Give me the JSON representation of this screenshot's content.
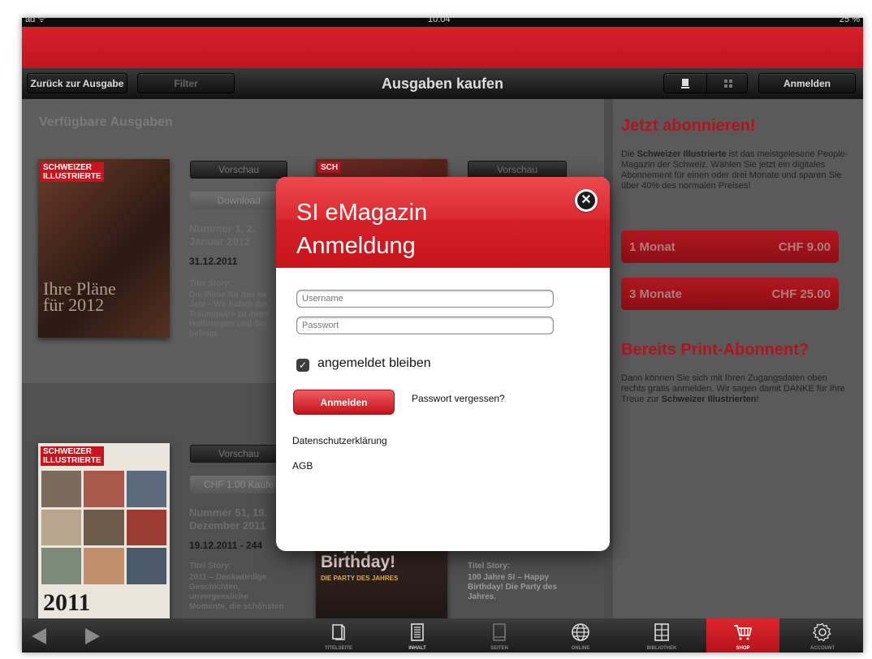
{
  "status": {
    "left": "ad ᯤ",
    "time": "10:04",
    "battery": "25 %"
  },
  "nav": {
    "back_label": "Zurück zur Ausgabe",
    "filter_label": "Filter",
    "title": "Ausgaben kaufen",
    "login_label": "Anmelden"
  },
  "available": {
    "heading": "Verfügbare Ausgaben",
    "issues": [
      {
        "cover_masthead": "SCHWEIZER\nILLUSTRIERTE",
        "cover_headline": "Ihre Pläne\nfür 2012",
        "preview_label": "Vorschau",
        "action_label": "Download",
        "number": "Nummer 1, 2.\nJanuar 2012",
        "date": "31.12.2011",
        "story_label": "Titel Story:",
        "story": "Die Pläne für das ne\nJahr - Wir haben dre\nTraumpaare zu ihren\nHoffnungen und Sor\nbefragt."
      },
      {
        "cover_masthead": "SCH",
        "preview_label": "Vorschau"
      },
      {
        "cover_masthead": "SCHWEIZER\nILLUSTRIERTE",
        "cover_headline": "2011",
        "preview_label": "Vorschau",
        "action_label": "CHF 1.00 Kaufe",
        "number": "Nummer 51, 19.\nDezember 2011",
        "date": "19.12.2011 - 244",
        "story_label": "Titel Story:",
        "story": "2011 – Denkwürdige\nGeschichten,\nunvergessliche\nMomente, die schönsten"
      },
      {
        "cover_headline": "Happy\nBirthday!",
        "cover_sub": "DIE PARTY DES JAHRES",
        "story_label": "Titel Story:",
        "story": "100 Jahre SI – Happy\nBirthday! Die Party des\nJahres."
      }
    ]
  },
  "sidebar": {
    "abo_title": "Jetzt abonnieren!",
    "abo_text_before": "Die ",
    "abo_text_bold": "Schweizer Illustrierte",
    "abo_text_after": " ist das meistgelesene People-Magazin der Schweiz. Wählen Sie jetzt ein digitales Abonnement für einen oder drei Monate und sparen Sie über 40% des normalen Preises!",
    "plans": [
      {
        "label": "1 Monat",
        "price": "CHF 9.00"
      },
      {
        "label": "3 Monate",
        "price": "CHF 25.00"
      }
    ],
    "print_title": "Bereits Print-Abonnent?",
    "print_text_before": "Dann können Sie sich mit Ihren Zugangsdaten oben rechts gratis anmelden. Wir sagen damit DANKE für Ihre Treue zur ",
    "print_text_bold": "Schweizer Illustrierten",
    "print_text_after": "!"
  },
  "tabbar": {
    "tabs": [
      {
        "label": "TITELSEITE",
        "icon": "page-icon"
      },
      {
        "label": "INHALT",
        "icon": "list-icon"
      },
      {
        "label": "SEITEN",
        "icon": "tablet-icon"
      },
      {
        "label": "ONLINE",
        "icon": "globe-icon"
      },
      {
        "label": "BIBLIOTHEK",
        "icon": "grid-icon"
      },
      {
        "label": "SHOP",
        "icon": "cart-icon"
      },
      {
        "label": "ACCOUNT",
        "icon": "gear-icon"
      }
    ]
  },
  "dialog": {
    "title_line1": "SI eMagazin",
    "title_line2": "Anmeldung",
    "username_placeholder": "Username",
    "password_placeholder": "Passwort",
    "remember_label": "angemeldet bleiben",
    "remember_checked": true,
    "login_button": "Anmelden",
    "forgot_label": "Passwort vergessen?",
    "privacy_label": "Datenschutzerklärung",
    "agb_label": "AGB"
  },
  "colors": {
    "brand_red": "#d31f26",
    "dark": "#1a1a1a"
  }
}
